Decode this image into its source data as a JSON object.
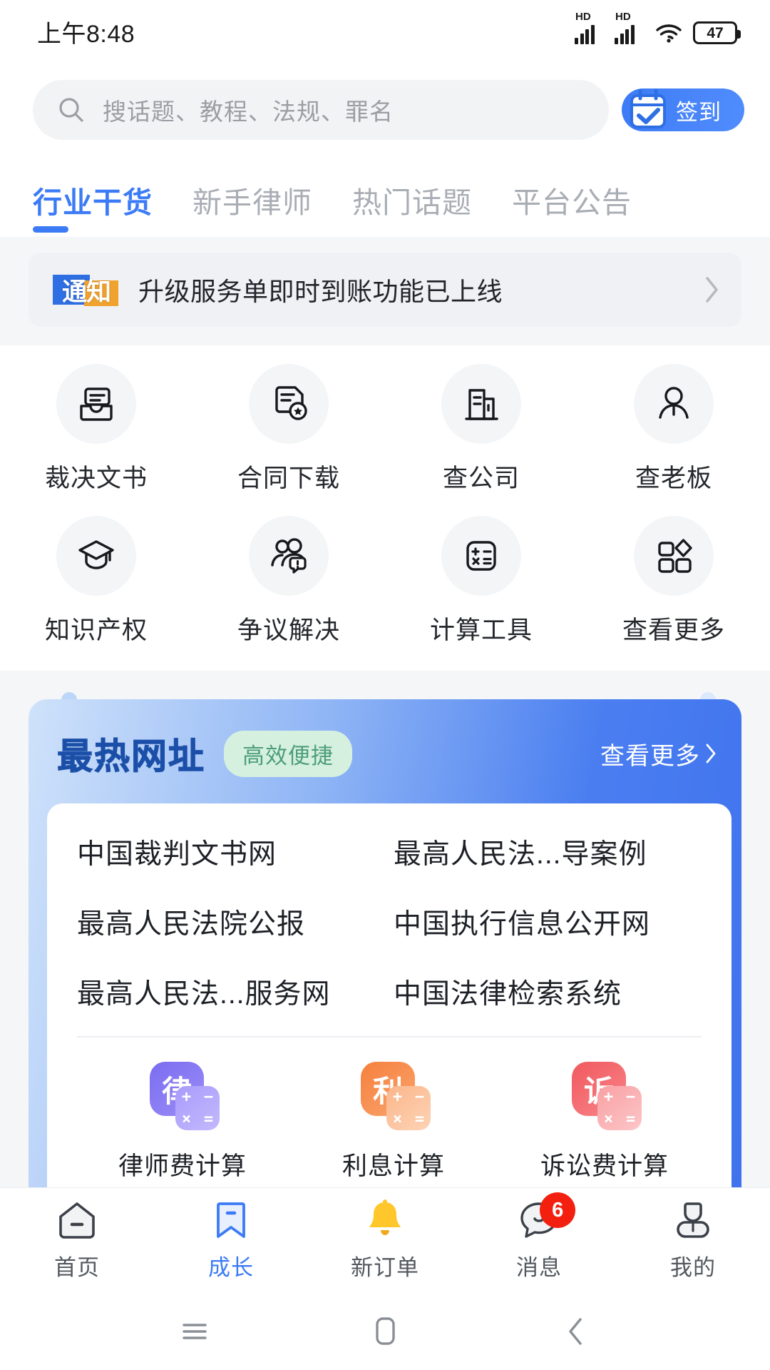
{
  "status_bar": {
    "time": "上午8:48",
    "network_label": "HD",
    "battery_percent": "47",
    "icons": [
      "signal-hd-1",
      "signal-hd-2",
      "wifi",
      "battery"
    ]
  },
  "search": {
    "placeholder": "搜话题、教程、法规、罪名",
    "icon": "search-icon",
    "signin_label": "签到",
    "signin_icon": "calendar-check-icon"
  },
  "tabs": [
    {
      "label": "行业干货",
      "active": true
    },
    {
      "label": "新手律师",
      "active": false
    },
    {
      "label": "热门话题",
      "active": false
    },
    {
      "label": "平台公告",
      "active": false
    }
  ],
  "notice": {
    "badge": "通知",
    "text": "升级服务单即时到账功能已上线",
    "arrow_icon": "chevron-right-icon"
  },
  "quick_grid": [
    {
      "label": "裁决文书",
      "icon": "document-inbox-icon"
    },
    {
      "label": "合同下载",
      "icon": "document-star-icon"
    },
    {
      "label": "查公司",
      "icon": "building-icon"
    },
    {
      "label": "查老板",
      "icon": "person-icon"
    },
    {
      "label": "知识产权",
      "icon": "graduation-cap-icon"
    },
    {
      "label": "争议解决",
      "icon": "people-alert-icon"
    },
    {
      "label": "计算工具",
      "icon": "calculator-icon"
    },
    {
      "label": "查看更多",
      "icon": "grid-apps-icon"
    }
  ],
  "hot_sites": {
    "title": "最热网址",
    "tag": "高效便捷",
    "more_label": "查看更多",
    "more_icon": "chevron-right-icon",
    "links": [
      "中国裁判文书网",
      "最高人民法...导案例",
      "最高人民法院公报",
      "中国执行信息公开网",
      "最高人民法...服务网",
      "中国法律检索系统"
    ],
    "calculators": [
      {
        "label": "律师费计算",
        "glyph": "律",
        "color": "#7b6cf0",
        "color2": "#9b8ef7",
        "icon": "lawyer-fee-calculator-icon"
      },
      {
        "label": "利息计算",
        "glyph": "利",
        "color": "#f5803e",
        "color2": "#fba46d",
        "icon": "interest-calculator-icon"
      },
      {
        "label": "诉讼费计算",
        "glyph": "诉",
        "color": "#f0595e",
        "color2": "#f9868a",
        "icon": "litigation-fee-calculator-icon"
      }
    ],
    "calc_ops": [
      "+",
      "−",
      "×",
      "="
    ]
  },
  "bottom_nav": [
    {
      "label": "首页",
      "icon": "home-icon",
      "active": false,
      "badge": ""
    },
    {
      "label": "成长",
      "icon": "bookmark-icon",
      "active": true,
      "badge": ""
    },
    {
      "label": "新订单",
      "icon": "bell-icon",
      "active": false,
      "badge": ""
    },
    {
      "label": "消息",
      "icon": "chat-icon",
      "active": false,
      "badge": "6"
    },
    {
      "label": "我的",
      "icon": "profile-icon",
      "active": false,
      "badge": ""
    }
  ],
  "android_nav": [
    {
      "icon": "recents-menu-icon"
    },
    {
      "icon": "home-square-icon"
    },
    {
      "icon": "back-chevron-icon"
    }
  ],
  "colors": {
    "accent": "#3c7bf5",
    "badge_red": "#f3200f",
    "page_bg": "#f5f6f8",
    "tag_green": "#4d9e78"
  }
}
